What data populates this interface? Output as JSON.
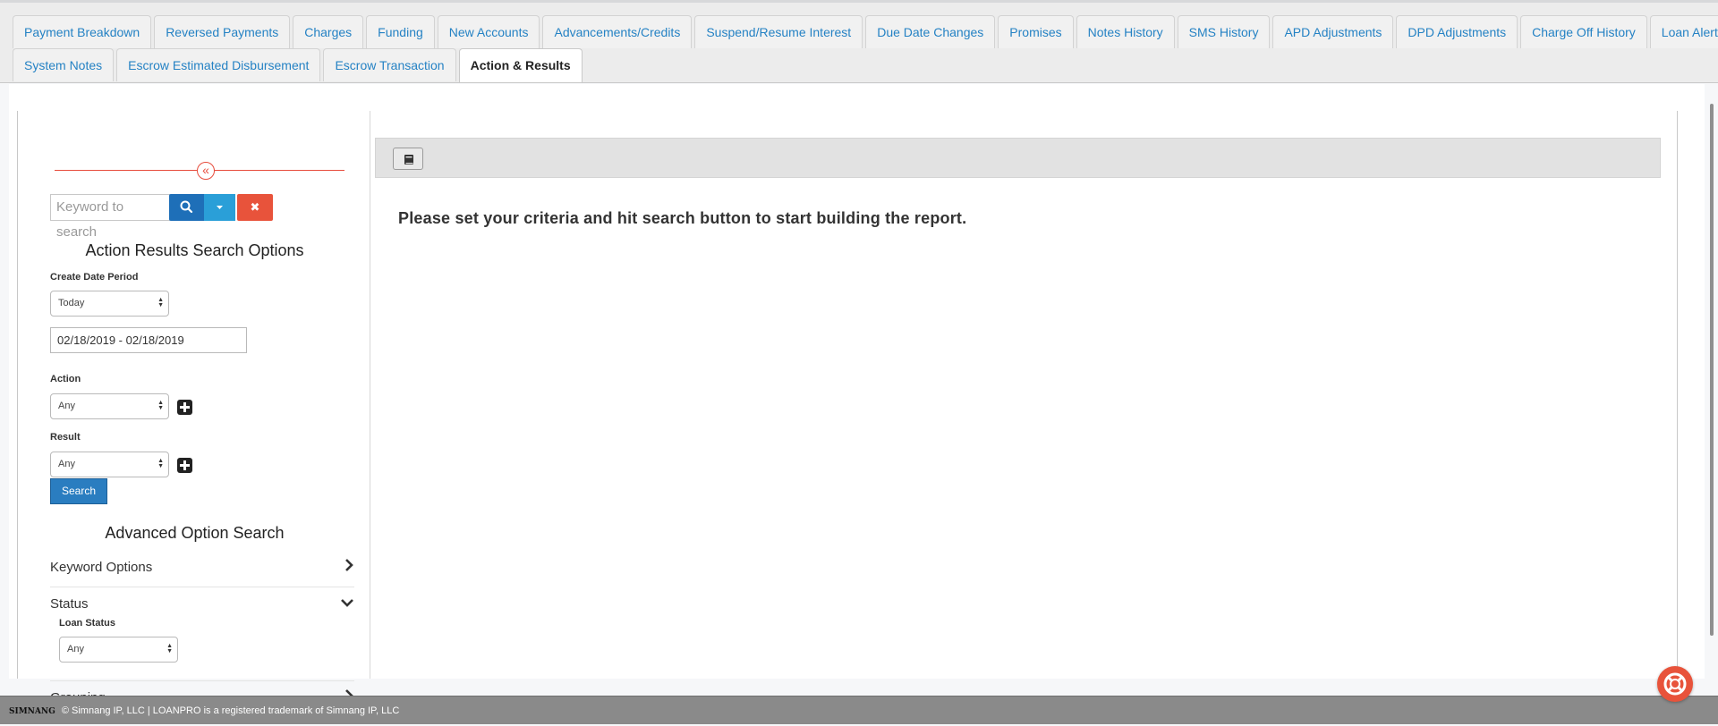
{
  "tabs_row1": [
    {
      "label": "Payment Breakdown"
    },
    {
      "label": "Reversed Payments"
    },
    {
      "label": "Charges"
    },
    {
      "label": "Funding"
    },
    {
      "label": "New Accounts"
    },
    {
      "label": "Advancements/Credits"
    },
    {
      "label": "Suspend/Resume Interest"
    },
    {
      "label": "Due Date Changes"
    },
    {
      "label": "Promises"
    },
    {
      "label": "Notes History"
    },
    {
      "label": "SMS History"
    },
    {
      "label": "APD Adjustments"
    },
    {
      "label": "DPD Adjustments"
    },
    {
      "label": "Charge Off History"
    },
    {
      "label": "Loan Alerts"
    }
  ],
  "tabs_row2": [
    {
      "label": "System Notes"
    },
    {
      "label": "Escrow Estimated Disbursement"
    },
    {
      "label": "Escrow Transaction"
    },
    {
      "label": "Action & Results",
      "active": true
    }
  ],
  "sidebar": {
    "collapse_glyph": "«",
    "search_placeholder": "Keyword to search",
    "clear_glyph": "✖",
    "title": "Action Results Search Options",
    "create_date_label": "Create Date Period",
    "create_date_value": "Today",
    "date_range": "02/18/2019 - 02/18/2019",
    "action_label": "Action",
    "action_value": "Any",
    "result_label": "Result",
    "result_value": "Any",
    "search_button": "Search",
    "advanced_title": "Advanced Option Search",
    "keyword_options": "Keyword Options",
    "status": "Status",
    "loan_status_label": "Loan Status",
    "loan_status_value": "Any",
    "grouping": "Grouping"
  },
  "main": {
    "message": "Please set your criteria and hit search button to start building the report."
  },
  "footer": {
    "logo": "SIMNANG",
    "text": "© Simnang IP, LLC | LOANPRO is a registered trademark of Simnang IP, LLC"
  },
  "colors": {
    "accent_red": "#e8533b",
    "primary_blue": "#1e6fb8",
    "tab_link": "#2582c4"
  }
}
